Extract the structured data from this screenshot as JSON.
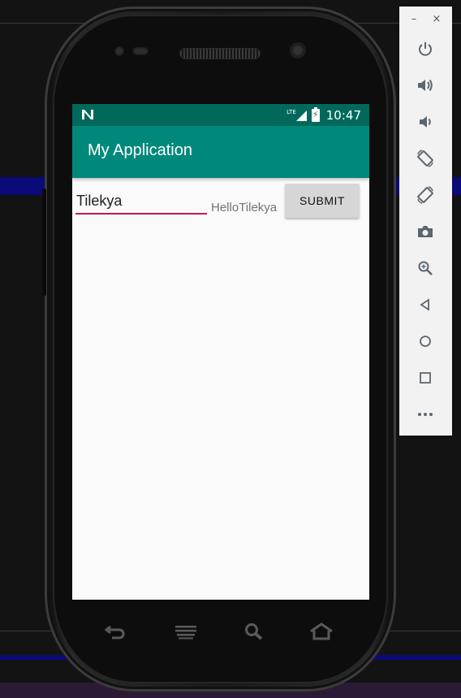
{
  "status_bar": {
    "notification_icon": "n-icon",
    "network_label": "LTE",
    "time": "10:47"
  },
  "app_bar": {
    "title": "My Application"
  },
  "form": {
    "input_value": "Tilekya",
    "greeting_text": "HelloTilekya",
    "submit_label": "SUBMIT"
  },
  "hardware_nav": [
    "back-icon",
    "menu-icon",
    "search-icon",
    "home-icon"
  ],
  "emulator_controls": {
    "window_min": "–",
    "window_close": "×",
    "buttons": [
      "power-icon",
      "volume-up-icon",
      "volume-down-icon",
      "rotate-left-icon",
      "rotate-right-icon",
      "camera-icon",
      "zoom-icon",
      "back-icon",
      "home-icon",
      "overview-icon",
      "more-icon"
    ]
  },
  "colors": {
    "status_bar": "#00695c",
    "app_bar": "#00897b",
    "accent": "#c2185b",
    "screen_background": "#fafafa",
    "button": "#d6d6d6"
  }
}
